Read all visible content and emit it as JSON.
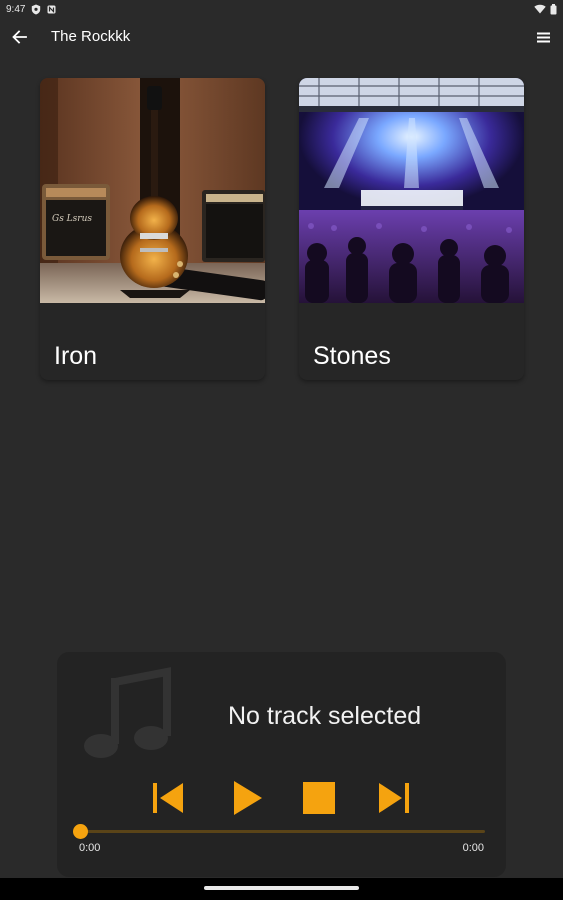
{
  "status_bar": {
    "time": "9:47",
    "icons": [
      "shield-icon",
      "notification-icon",
      "wifi-icon",
      "battery-icon"
    ]
  },
  "app_bar": {
    "title": "The Rockkk",
    "back_icon": "arrow-left-icon",
    "menu_icon": "hamburger-menu-icon"
  },
  "albums": [
    {
      "title": "Iron",
      "image": "guitar-with-amplifiers-image"
    },
    {
      "title": "Stones",
      "image": "concert-crowd-stage-image"
    }
  ],
  "player": {
    "track_title": "No track selected",
    "art_icon": "music-note-icon",
    "controls": [
      "skip-previous-icon",
      "play-icon",
      "stop-icon",
      "skip-next-icon"
    ],
    "elapsed": "0:00",
    "total": "0:00",
    "progress": 0
  },
  "colors": {
    "background": "#2a2a2a",
    "card": "#262626",
    "player": "#232323",
    "accent": "#f5a30f",
    "seek_track": "#5a4418",
    "nav_bar": "#000000"
  }
}
